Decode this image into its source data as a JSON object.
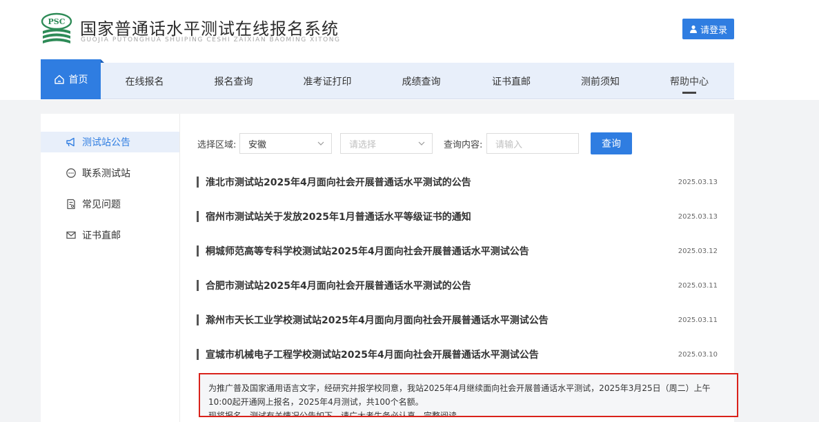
{
  "header": {
    "title": "国家普通话水平测试在线报名系统",
    "subtitle": "GUOJIA PUTONGHUA SHUIPING CESHI ZAIXIAN BAOMING XITONG",
    "logo_text": "PSC",
    "login_label": "请登录",
    "login_icon": "user-icon",
    "accent_color": "#2f7de1"
  },
  "nav": {
    "items": [
      {
        "label": "首页",
        "active": true,
        "icon": "home-icon"
      },
      {
        "label": "在线报名"
      },
      {
        "label": "报名查询"
      },
      {
        "label": "准考证打印"
      },
      {
        "label": "成绩查询"
      },
      {
        "label": "证书直邮"
      },
      {
        "label": "测前须知"
      },
      {
        "label": "帮助中心"
      }
    ]
  },
  "sidebar": {
    "items": [
      {
        "label": "测试站公告",
        "icon": "announcement-icon",
        "active": true
      },
      {
        "label": "联系测试站",
        "icon": "chat-icon"
      },
      {
        "label": "常见问题",
        "icon": "document-icon"
      },
      {
        "label": "证书直邮",
        "icon": "mail-icon"
      }
    ]
  },
  "filter": {
    "region_label": "选择区域:",
    "region_value": "安徽",
    "city_placeholder": "请选择",
    "query_label": "查询内容:",
    "query_placeholder": "请输入",
    "search_label": "查询"
  },
  "announcements": [
    {
      "title": "淮北市测试站2025年4月面向社会开展普通话水平测试的公告",
      "date": "2025.03.13"
    },
    {
      "title": "宿州市测试站关于发放2025年1月普通话水平等级证书的通知",
      "date": "2025.03.13"
    },
    {
      "title": "桐城师范高等专科学校测试站2025年4月面向社会开展普通话水平测试公告",
      "date": "2025.03.12"
    },
    {
      "title": "合肥市测试站2025年4月面向社会开展普通话水平测试的公告",
      "date": "2025.03.11"
    },
    {
      "title": "滁州市天长工业学校测试站2025年4月面向月面向社会开展普通话水平测试公告",
      "date": "2025.03.11"
    },
    {
      "title": "宣城市机械电子工程学校测试站2025年4月面向社会开展普通话水平测试公告",
      "date": "2025.03.10"
    }
  ],
  "notice": {
    "line1": "为推广普及国家通用语言文字，经研究并报学校同意，我站2025年4月继续面向社会开展普通话水平测试，2025年3月25日（周二）上午",
    "line2": "10:00起开通网上报名，2025年4月测试，共100个名额。",
    "line3": "现将报名、测试有关情况公告如下，请广大考生务必认真、完整阅读。"
  }
}
